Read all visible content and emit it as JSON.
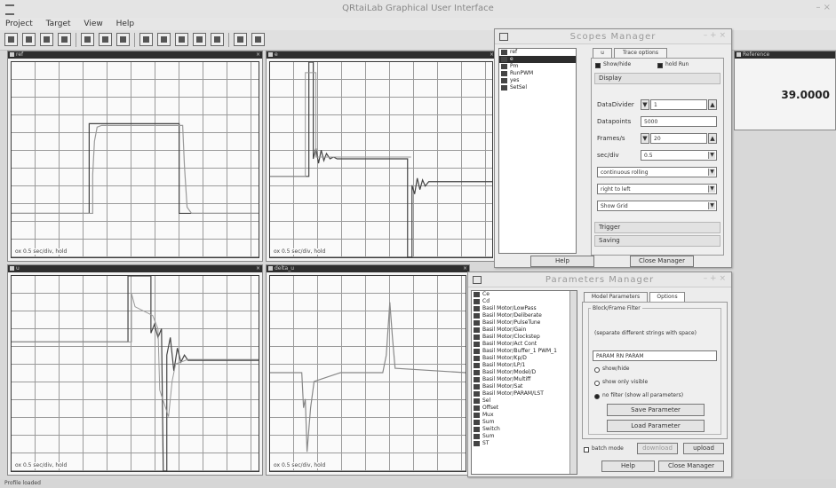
{
  "app": {
    "title": "QRtaiLab Graphical User Interface"
  },
  "menu": [
    "Project",
    "Target",
    "View",
    "Help"
  ],
  "scopes": [
    {
      "name": "ref",
      "label": "ox 0.5 sec/div, hold"
    },
    {
      "name": "e",
      "label": "ox 0.5 sec/div, hold"
    },
    {
      "name": "u",
      "label": "ox 0.5 sec/div, hold"
    },
    {
      "name": "delta_u",
      "label": "ox 0.5 sec/div, hold"
    }
  ],
  "meter": {
    "name": "Reference",
    "value": "39.0000"
  },
  "scopes_manager": {
    "title": "Scopes Manager",
    "list": [
      "ref",
      "e",
      "Pm",
      "RunPWM",
      "yes",
      "SetSel"
    ],
    "selected": 1,
    "tabs": [
      "u",
      "Trace options"
    ],
    "check_label_1": "Show/hide",
    "check_label_2": "hold Run",
    "section_display": "Display",
    "data_divider_label": "DataDivider",
    "data_divider_value": "1",
    "datapoints_label": "Datapoints",
    "datapoints_value": "5000",
    "frames_label": "Frames/s",
    "frames_value": "20",
    "sec_div_label": "sec/div",
    "sec_div_value": "0.5",
    "mode_value": "continuous rolling",
    "direction_value": "right to left",
    "grid_value": "Show Grid",
    "section_trigger": "Trigger",
    "section_saving": "Saving",
    "help_btn": "Help",
    "close_btn": "Close Manager"
  },
  "parameters_manager": {
    "title": "Parameters Manager",
    "list": [
      "Ce",
      "Cd",
      "Basil Motor/LowPass",
      "Basil Motor/Deliberate",
      "Basil Motor/PulseTune",
      "Basil Motor/Gain",
      "Basil Motor/Clockstep",
      "Basil Motor/Act Cont",
      "Basil Motor/Buffer_1 PWM_1",
      "Basil Motor/Kp/D",
      "Basil Motor/LP/1",
      "Basil Motor/Model/D",
      "Basil Motor/Multiff",
      "Basil Motor/Sat",
      "Basil Motor/PARAM/LST",
      "Sel",
      "Offset",
      "Mux",
      "Sum",
      "Switch",
      "Sum",
      "ST"
    ],
    "tabs": [
      "Model Parameters",
      "Options"
    ],
    "group_label": "Block/Frame Filter",
    "filter_hint": "(separate different strings with space)",
    "filter_value": "PARAM RN PARAM",
    "radio_1": "show/hide",
    "radio_2": "show only visible",
    "radio_3": "no filter (show all parameters)",
    "save_btn": "Save Parameter",
    "load_btn": "Load Parameter",
    "batch_label": "batch mode",
    "download_btn": "download",
    "upload_btn": "upload",
    "help_btn": "Help",
    "close_btn": "Close Manager"
  },
  "status": {
    "text": "Profile loaded"
  }
}
